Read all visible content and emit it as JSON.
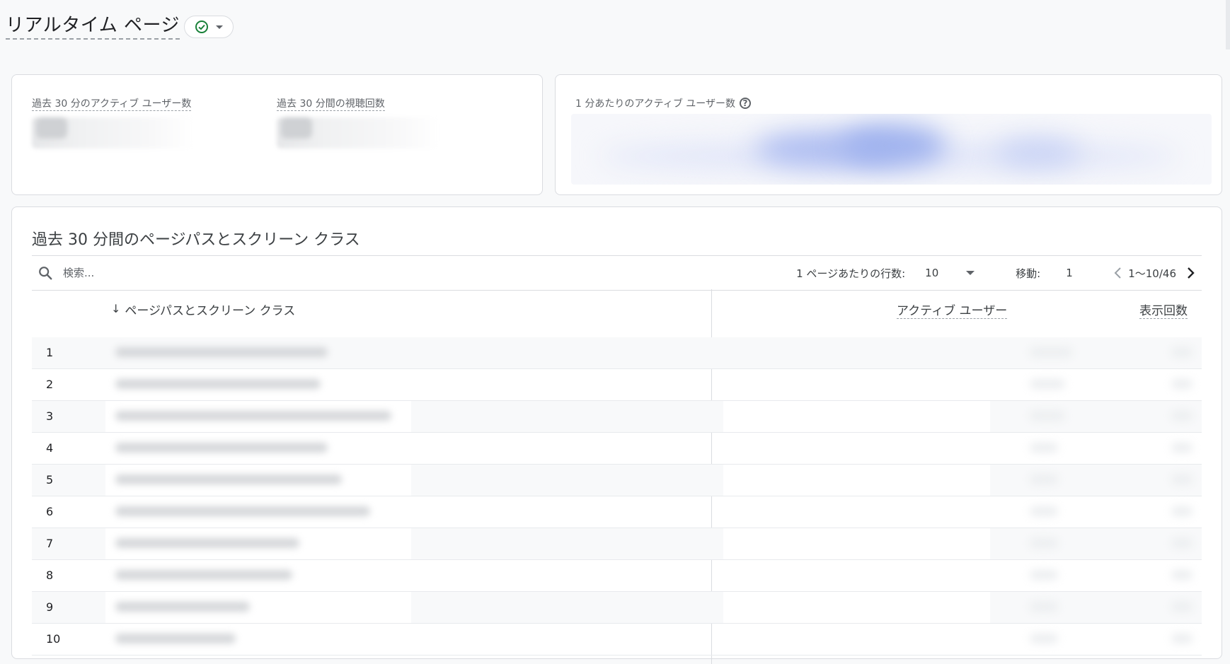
{
  "header": {
    "title": "リアルタイム ページ",
    "status_icon": "check-circle-icon",
    "status_color": "#188038"
  },
  "metrics": [
    {
      "label": "過去 30 分のアクティブ ユーザー数"
    },
    {
      "label": "過去 30 分間の視聴回数"
    }
  ],
  "chart": {
    "title": "1 分あたりのアクティブ ユーザー数",
    "help_glyph": "?",
    "accent_color": "#aebdf1"
  },
  "table": {
    "title": "過去 30 分間のページパスとスクリーン クラス",
    "search_placeholder": "検索...",
    "rows_per_page_label": "1 ページあたりの行数:",
    "rows_per_page_value": "10",
    "goto_label": "移動:",
    "goto_value": "1",
    "range_text": "1〜10/46",
    "columns": {
      "path": "ページパスとスクリーン クラス",
      "sort_glyph": "↓",
      "users": "アクティブ ユーザー",
      "views": "表示回数"
    },
    "rows": [
      {
        "index": "1"
      },
      {
        "index": "2"
      },
      {
        "index": "3"
      },
      {
        "index": "4"
      },
      {
        "index": "5"
      },
      {
        "index": "6"
      },
      {
        "index": "7"
      },
      {
        "index": "8"
      },
      {
        "index": "9"
      },
      {
        "index": "10"
      }
    ]
  }
}
